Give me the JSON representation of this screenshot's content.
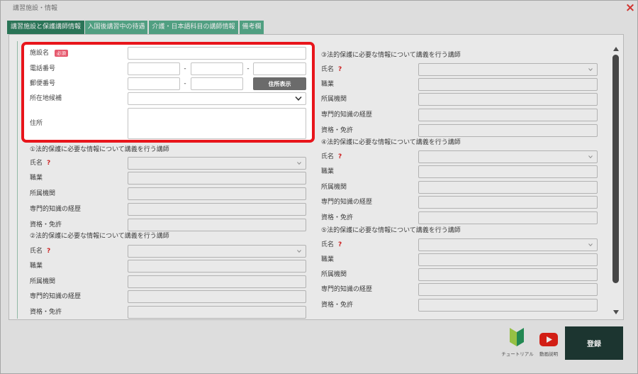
{
  "window": {
    "title": "講習施設・情報",
    "close_glyph": "×"
  },
  "tabs": [
    {
      "label": "講習施設と保護講師情報",
      "active": true
    },
    {
      "label": "入国後講習中の待遇",
      "active": false
    },
    {
      "label": "介護・日本語科目の講師情報",
      "active": false
    },
    {
      "label": "備考欄",
      "active": false
    }
  ],
  "facility": {
    "name": {
      "label": "施設名",
      "required_badge": "必須",
      "value": ""
    },
    "phone": {
      "label": "電話番号",
      "separator": "-",
      "values": [
        "",
        "",
        ""
      ]
    },
    "postal": {
      "label": "郵便番号",
      "separator": "-",
      "values": [
        "",
        ""
      ],
      "lookup_button": "住所表示"
    },
    "location_candidates": {
      "label": "所在地候補",
      "selected": ""
    },
    "address": {
      "label": "住所",
      "value": ""
    }
  },
  "lecturers": [
    {
      "heading": "①法的保護に必要な情報について講義を行う講師",
      "name": {
        "label": "氏名",
        "help": "?",
        "selected": ""
      },
      "occupation": {
        "label": "職業",
        "value": ""
      },
      "affiliation": {
        "label": "所属機関",
        "value": ""
      },
      "expertise": {
        "label": "専門的知識の経歴",
        "value": ""
      },
      "qualifications": {
        "label": "資格・免許",
        "value": ""
      }
    },
    {
      "heading": "②法的保護に必要な情報について講義を行う講師",
      "name": {
        "label": "氏名",
        "help": "?",
        "selected": ""
      },
      "occupation": {
        "label": "職業",
        "value": ""
      },
      "affiliation": {
        "label": "所属機関",
        "value": ""
      },
      "expertise": {
        "label": "専門的知識の経歴",
        "value": ""
      },
      "qualifications": {
        "label": "資格・免許",
        "value": ""
      }
    },
    {
      "heading": "③法的保護に必要な情報について講義を行う講師",
      "name": {
        "label": "氏名",
        "help": "?",
        "selected": ""
      },
      "occupation": {
        "label": "職業",
        "value": ""
      },
      "affiliation": {
        "label": "所属機関",
        "value": ""
      },
      "expertise": {
        "label": "専門的知識の経歴",
        "value": ""
      },
      "qualifications": {
        "label": "資格・免許",
        "value": ""
      }
    },
    {
      "heading": "④法的保護に必要な情報について講義を行う講師",
      "name": {
        "label": "氏名",
        "help": "?",
        "selected": ""
      },
      "occupation": {
        "label": "職業",
        "value": ""
      },
      "affiliation": {
        "label": "所属機関",
        "value": ""
      },
      "expertise": {
        "label": "専門的知識の経歴",
        "value": ""
      },
      "qualifications": {
        "label": "資格・免許",
        "value": ""
      }
    },
    {
      "heading": "⑤法的保護に必要な情報について講義を行う講師",
      "name": {
        "label": "氏名",
        "help": "?",
        "selected": ""
      },
      "occupation": {
        "label": "職業",
        "value": ""
      },
      "affiliation": {
        "label": "所属機関",
        "value": ""
      },
      "expertise": {
        "label": "専門的知識の経歴",
        "value": ""
      },
      "qualifications": {
        "label": "資格・免許",
        "value": ""
      }
    }
  ],
  "footer": {
    "tutorial_label": "チュートリアル",
    "video_label": "動画説明",
    "register_button": "登録"
  },
  "icons": {
    "close": "close-icon",
    "tutorial": "beginner-mark-icon",
    "video": "video-play-icon",
    "select": "chevron-down-icon",
    "scroll_up": "scroll-up-arrow-icon",
    "scroll_down": "scroll-down-arrow-icon",
    "help": "help-icon"
  },
  "colors": {
    "active_tab": "#2f7f60",
    "tab": "#58ae8e",
    "highlight_border": "#e8151b",
    "required_badge": "#e65a6e",
    "help_mark": "#e02424",
    "close": "#e53935",
    "address_button": "#6b6b6b",
    "register_button": "#1f3b35",
    "scroll_thumb": "#4d4d4d"
  }
}
